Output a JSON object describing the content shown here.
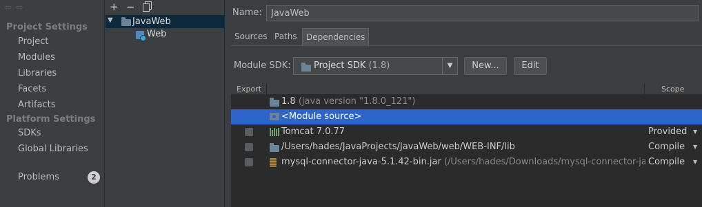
{
  "nav": {
    "back_icon": "back-arrow-icon",
    "forward_icon": "forward-arrow-icon",
    "project_settings_header": "Project Settings",
    "project_items": [
      "Project",
      "Modules",
      "Libraries",
      "Facets",
      "Artifacts"
    ],
    "platform_settings_header": "Platform Settings",
    "platform_items": [
      "SDKs",
      "Global Libraries"
    ],
    "problems_label": "Problems",
    "problems_count": "2"
  },
  "tree": {
    "add_icon": "+",
    "remove_icon": "−",
    "copy_icon": "copy-icon",
    "root_label": "JavaWeb",
    "child_label": "Web"
  },
  "module": {
    "name_label": "Name:",
    "name_value": "JavaWeb",
    "tabs": [
      "Sources",
      "Paths",
      "Dependencies"
    ],
    "active_tab": "Dependencies",
    "sdk_label": "Module SDK:",
    "sdk_value": "Project SDK",
    "sdk_version": "(1.8)",
    "new_button": "New...",
    "edit_button": "Edit"
  },
  "dependencies": {
    "col_export": "Export",
    "col_scope": "Scope",
    "rows": [
      {
        "name": "1.8",
        "detail": "(java version \"1.8.0_121\")",
        "scope": "",
        "icon": "sdk-folder-icon",
        "checkbox": false
      },
      {
        "name": "<Module source>",
        "detail": "",
        "scope": "",
        "icon": "module-source-icon",
        "checkbox": false,
        "selected": true
      },
      {
        "name": "Tomcat 7.0.77",
        "detail": "",
        "scope": "Provided",
        "icon": "library-icon",
        "checkbox": true
      },
      {
        "name": "/Users/hades/JavaProjects/JavaWeb/web/WEB-INF/lib",
        "detail": "",
        "scope": "Compile",
        "icon": "folder-icon",
        "checkbox": true
      },
      {
        "name": "mysql-connector-java-5.1.42-bin.jar",
        "detail": "(/Users/hades/Downloads/mysql-connector-java",
        "scope": "Compile",
        "icon": "jar-icon",
        "checkbox": true
      }
    ]
  }
}
